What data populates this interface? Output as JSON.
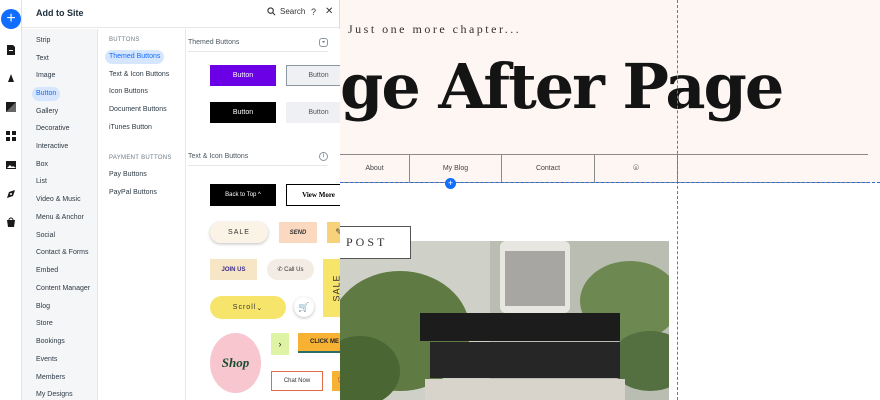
{
  "panel": {
    "title": "Add to Site",
    "search_label": "Search",
    "help_label": "?",
    "close_label": "✕"
  },
  "categories": [
    "Strip",
    "Text",
    "Image",
    "Button",
    "Gallery",
    "Decorative",
    "Interactive",
    "Box",
    "List",
    "Video & Music",
    "Menu & Anchor",
    "Social",
    "Contact & Forms",
    "Embed",
    "Content Manager",
    "Blog",
    "Store",
    "Bookings",
    "Events",
    "Members",
    "My Designs"
  ],
  "active_category": "Button",
  "subcategories": {
    "buttons_head": "BUTTONS",
    "buttons": [
      "Themed Buttons",
      "Text & Icon Buttons",
      "Icon Buttons",
      "Document Buttons",
      "iTunes Button"
    ],
    "payment_head": "PAYMENT BUTTONS",
    "payment": [
      "Pay Buttons",
      "PayPal Buttons"
    ]
  },
  "gallery": {
    "themed_title": "Themed Buttons",
    "themed_buttons": [
      "Button",
      "Button",
      "Button",
      "Button"
    ],
    "text_icon_title": "Text & Icon Buttons",
    "text_icon_buttons": {
      "back_to_top": "Back to Top",
      "view_more": "View More",
      "sale": "SALE",
      "send": "SEND",
      "join_us": "JOIN US",
      "call_us": "Call Us",
      "sale_vertical": "SALE",
      "scroll": "Scroll",
      "shop": "Shop",
      "click_me": "CLICK ME",
      "chat_now": "Chat Now"
    }
  },
  "colors": {
    "accent": "#116dff",
    "themed_primary": "#6b00e6",
    "canvas_hero_bg": "#fdf6f3"
  },
  "site": {
    "tagline": "Just one more chapter...",
    "title": "ge After Page",
    "nav": [
      "About",
      "My Blog",
      "Contact"
    ],
    "post_label": "POST"
  }
}
